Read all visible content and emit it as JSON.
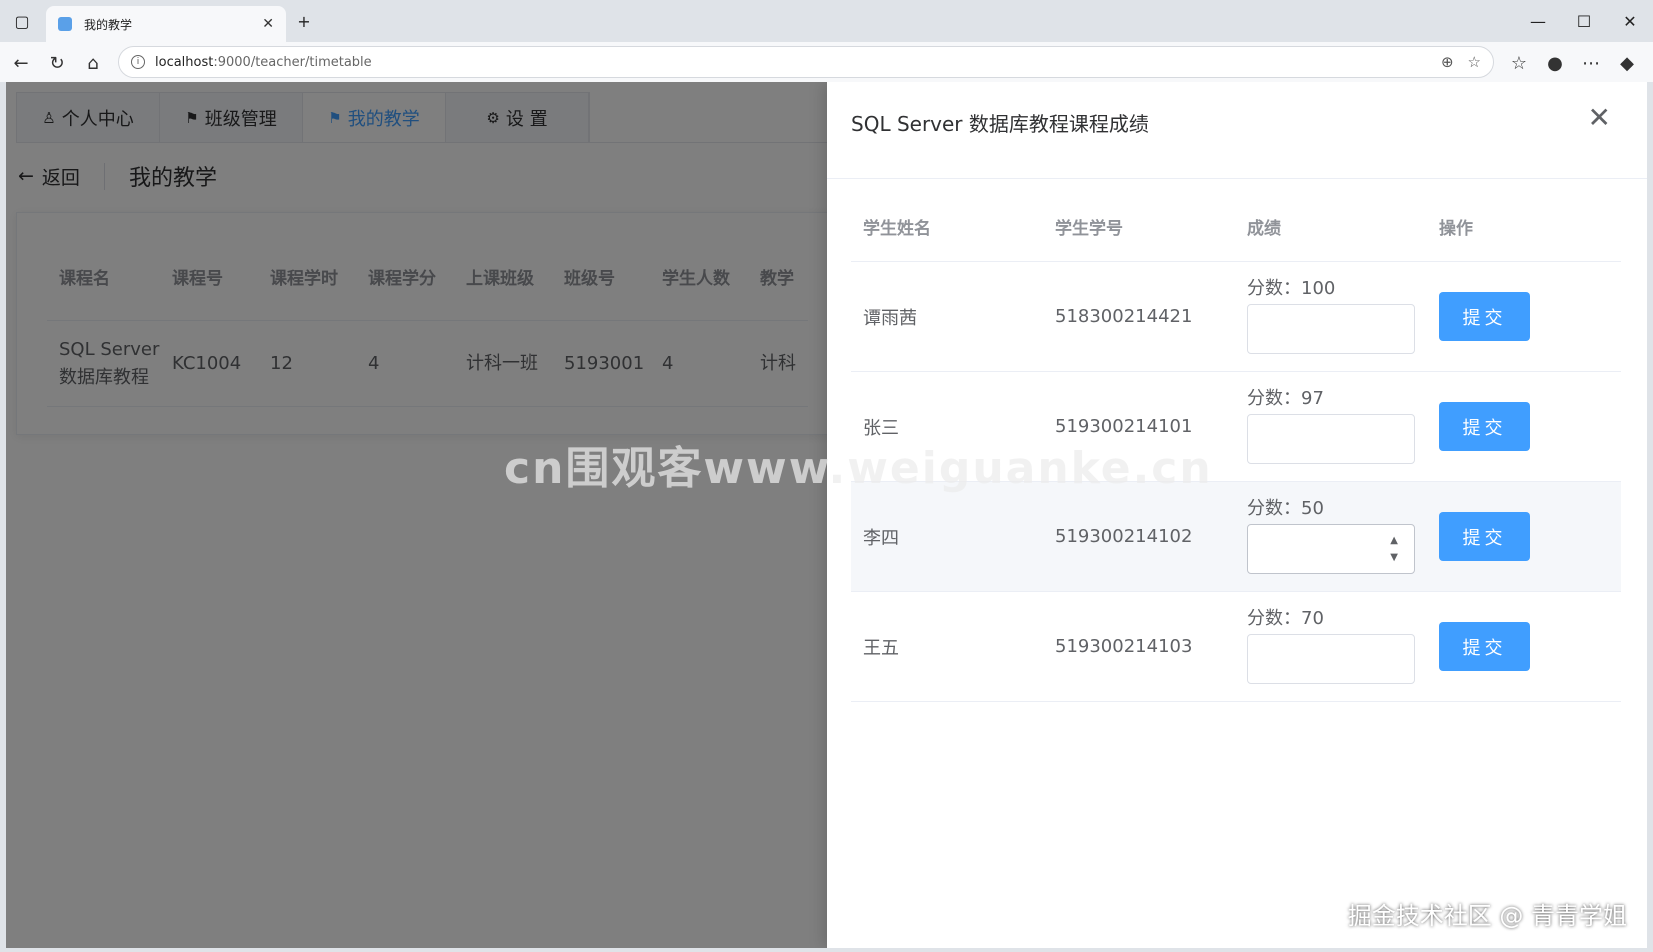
{
  "browser": {
    "tab_title": "我的教学",
    "url_host": "localhost",
    "url_path": ":9000/teacher/timetable"
  },
  "nav": {
    "tabs": [
      {
        "label": "个人中心",
        "icon": "user-icon"
      },
      {
        "label": "班级管理",
        "icon": "flag-icon"
      },
      {
        "label": "我的教学",
        "icon": "flag-icon"
      },
      {
        "label": "设 置",
        "icon": "gear-icon"
      }
    ],
    "active_index": 2
  },
  "header": {
    "back_label": "返回",
    "title": "我的教学"
  },
  "course_table": {
    "columns": [
      "课程名",
      "课程号",
      "课程学时",
      "课程学分",
      "上课班级",
      "班级号",
      "学生人数",
      "教学"
    ],
    "row": {
      "name_line1": "SQL Server",
      "name_line2": "数据库教程",
      "code": "KC1004",
      "hours": "12",
      "credits": "4",
      "class_name": "计科一班",
      "class_no": "5193001",
      "students": "4",
      "extra": "计科"
    }
  },
  "drawer": {
    "title": "SQL Server 数据库教程课程成绩",
    "columns": [
      "学生姓名",
      "学生学号",
      "成绩",
      "操作"
    ],
    "score_prefix": "分数：",
    "submit_label": "提交",
    "students": [
      {
        "name": "谭雨茜",
        "id": "518300214421",
        "score": "分数：100"
      },
      {
        "name": "张三",
        "id": "519300214101",
        "score": "分数：97"
      },
      {
        "name": "李四",
        "id": "519300214102",
        "score": "分数：50"
      },
      {
        "name": "王五",
        "id": "519300214103",
        "score": "分数：70"
      }
    ]
  },
  "watermark": "cn围观客www.weiguanke.cn",
  "credit": "掘金技术社区 @ 青青学姐"
}
